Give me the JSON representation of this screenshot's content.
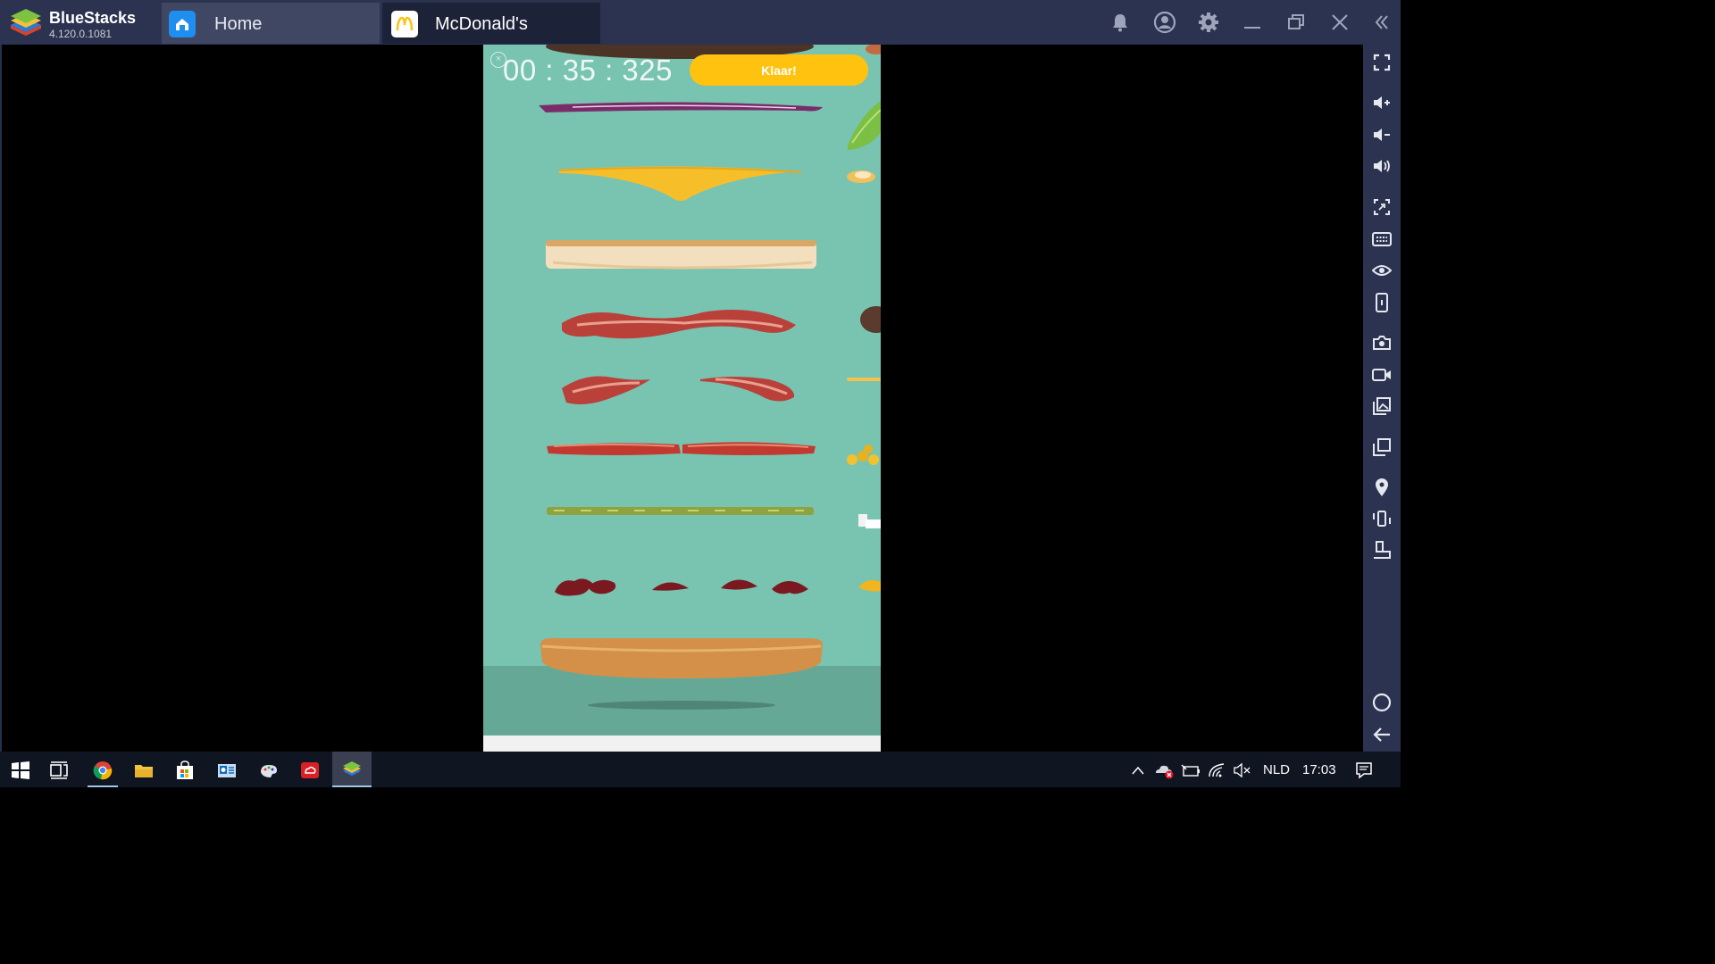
{
  "app": {
    "brand": "BlueStacks",
    "version": "4.120.0.1081"
  },
  "tabs": [
    {
      "label": "Home",
      "icon": "home-icon",
      "active": false
    },
    {
      "label": "McDonald's",
      "icon": "mcdonalds-logo-icon",
      "active": true
    }
  ],
  "window_controls": [
    "bell-icon",
    "account-icon",
    "gear-icon",
    "minimize-icon",
    "restore-icon",
    "close-icon",
    "collapse-sidebar-icon"
  ],
  "sidebar_icons": [
    "fullscreen-icon",
    "volume-up-icon",
    "volume-down-icon",
    "mute-icon",
    "screen-lock-icon",
    "keyboard-icon",
    "eye-icon",
    "phone-shake-icon",
    "camera-icon",
    "record-icon",
    "media-manager-icon",
    "multi-instance-icon",
    "location-icon",
    "rotate-icon",
    "portrait-icon",
    "home-circle-icon",
    "back-arrow-icon"
  ],
  "game": {
    "timer": "00 : 35 : 325",
    "done_button": "Klaar!",
    "accent": "#ffc20e",
    "background": "#79c3b1"
  },
  "taskbar": {
    "apps": [
      "windows-start-icon",
      "task-view-icon",
      "chrome-icon",
      "file-explorer-icon",
      "store-icon",
      "outlook-icon",
      "paint-icon",
      "adobe-cloud-icon",
      "bluestacks-icon"
    ],
    "tray": [
      "chevron-up-icon",
      "onedrive-error-icon",
      "battery-icon",
      "wifi-icon",
      "speaker-muted-icon",
      "notifications-icon"
    ],
    "language": "NLD",
    "time": "17:03"
  }
}
